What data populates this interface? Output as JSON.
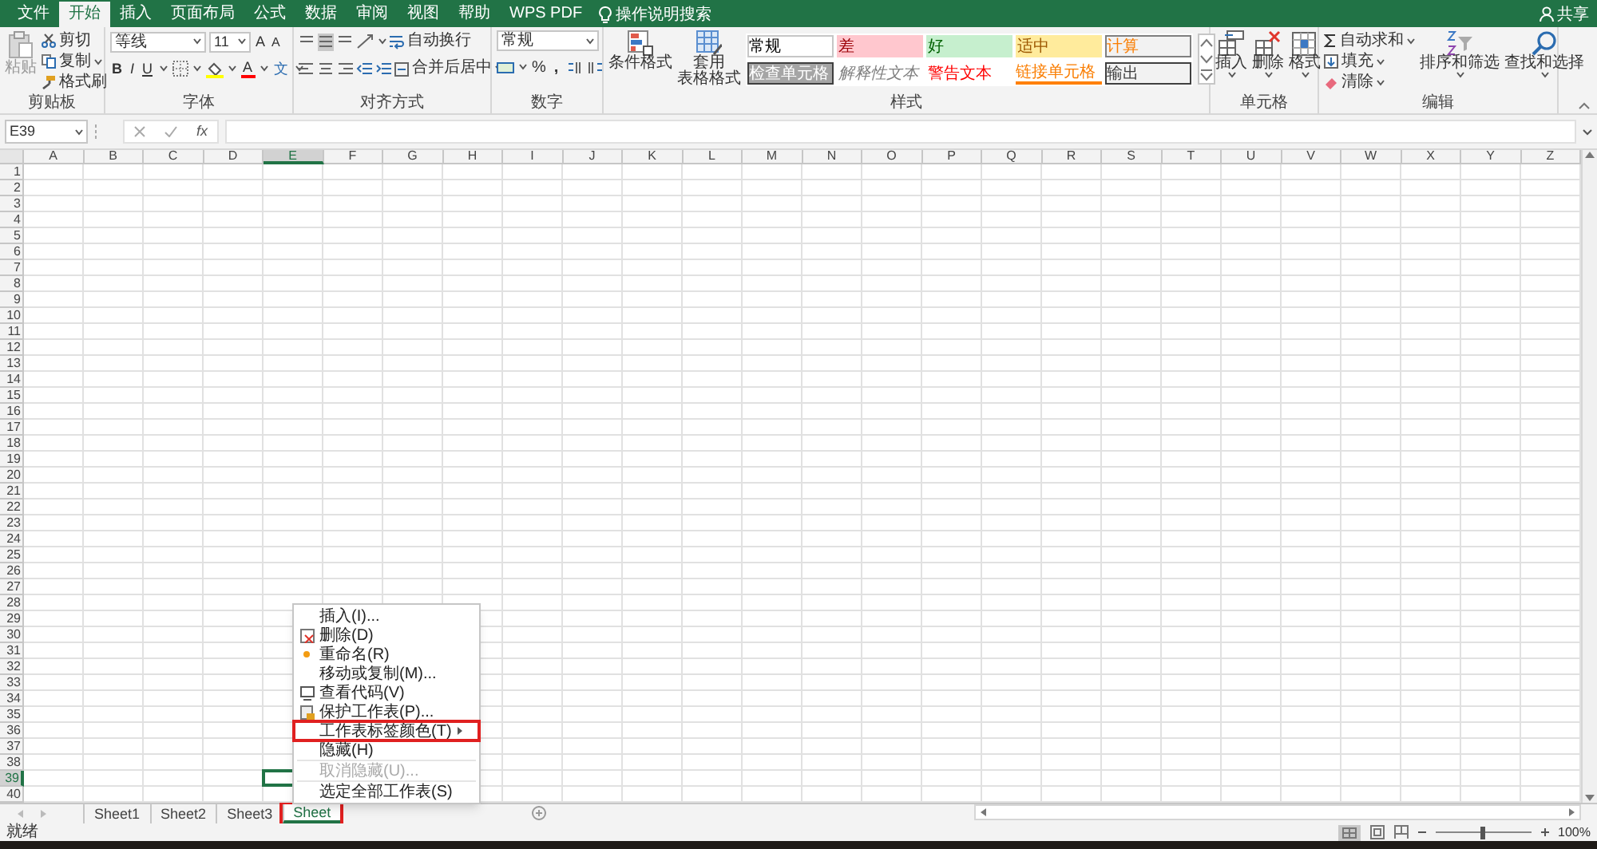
{
  "ribbon_tabs": [
    {
      "label": "文件",
      "selected": false
    },
    {
      "label": "开始",
      "selected": true
    },
    {
      "label": "插入",
      "selected": false
    },
    {
      "label": "页面布局",
      "selected": false
    },
    {
      "label": "公式",
      "selected": false
    },
    {
      "label": "数据",
      "selected": false
    },
    {
      "label": "审阅",
      "selected": false
    },
    {
      "label": "视图",
      "selected": false
    },
    {
      "label": "帮助",
      "selected": false
    },
    {
      "label": "WPS PDF",
      "selected": false
    }
  ],
  "tell_me": "操作说明搜索",
  "share": "共享",
  "clipboard": {
    "paste": "粘贴",
    "paste_disabled": true,
    "cut": "剪切",
    "copy": "复制",
    "format_painter": "格式刷",
    "label": "剪贴板"
  },
  "font": {
    "name": "等线",
    "size": "11",
    "grow": "A",
    "shrink": "A",
    "bold": "B",
    "italic": "I",
    "underline": "U",
    "color_letter": "A",
    "phonetic": "文",
    "label": "字体"
  },
  "alignment": {
    "wrap": "自动换行",
    "merge": "合并后居中",
    "label": "对齐方式"
  },
  "number": {
    "format": "常规",
    "percent": "%",
    "comma": ",",
    "label": "数字"
  },
  "styles": {
    "conditional": [
      "条件格式"
    ],
    "table": [
      "套用",
      "表格格式"
    ],
    "cell_styles": [
      {
        "label": "常规",
        "kind": "normal"
      },
      {
        "label": "差",
        "kind": "bad"
      },
      {
        "label": "好",
        "kind": "good"
      },
      {
        "label": "适中",
        "kind": "neutral"
      },
      {
        "label": "计算",
        "kind": "calculation"
      },
      {
        "label": "检查单元格",
        "kind": "check"
      },
      {
        "label": "解释性文本",
        "kind": "explanatory"
      },
      {
        "label": "警告文本",
        "kind": "warning"
      },
      {
        "label": "链接单元格",
        "kind": "linked"
      },
      {
        "label": "输出",
        "kind": "output"
      }
    ],
    "label": "样式"
  },
  "cells": {
    "buttons": [
      "插入",
      "删除",
      "格式"
    ],
    "label": "单元格"
  },
  "editing": {
    "autosum": "自动求和",
    "fill": "填充",
    "clear": "清除",
    "sort": "排序和筛选",
    "find": "查找和选择",
    "label": "编辑"
  },
  "formula_bar": {
    "name_box": "E39",
    "fx": "fx"
  },
  "columns": [
    {
      "label": "A",
      "selected": false
    },
    {
      "label": "B",
      "selected": false
    },
    {
      "label": "C",
      "selected": false
    },
    {
      "label": "D",
      "selected": false
    },
    {
      "label": "E",
      "selected": true
    },
    {
      "label": "F",
      "selected": false
    },
    {
      "label": "G",
      "selected": false
    },
    {
      "label": "H",
      "selected": false
    },
    {
      "label": "I",
      "selected": false
    },
    {
      "label": "J",
      "selected": false
    },
    {
      "label": "K",
      "selected": false
    },
    {
      "label": "L",
      "selected": false
    },
    {
      "label": "M",
      "selected": false
    },
    {
      "label": "N",
      "selected": false
    },
    {
      "label": "O",
      "selected": false
    },
    {
      "label": "P",
      "selected": false
    },
    {
      "label": "Q",
      "selected": false
    },
    {
      "label": "R",
      "selected": false
    },
    {
      "label": "S",
      "selected": false
    },
    {
      "label": "T",
      "selected": false
    },
    {
      "label": "U",
      "selected": false
    },
    {
      "label": "V",
      "selected": false
    },
    {
      "label": "W",
      "selected": false
    },
    {
      "label": "X",
      "selected": false
    },
    {
      "label": "Y",
      "selected": false
    },
    {
      "label": "Z",
      "selected": false
    }
  ],
  "rows": [
    {
      "label": "1",
      "selected": false
    },
    {
      "label": "2",
      "selected": false
    },
    {
      "label": "3",
      "selected": false
    },
    {
      "label": "4",
      "selected": false
    },
    {
      "label": "5",
      "selected": false
    },
    {
      "label": "6",
      "selected": false
    },
    {
      "label": "7",
      "selected": false
    },
    {
      "label": "8",
      "selected": false
    },
    {
      "label": "9",
      "selected": false
    },
    {
      "label": "10",
      "selected": false
    },
    {
      "label": "11",
      "selected": false
    },
    {
      "label": "12",
      "selected": false
    },
    {
      "label": "13",
      "selected": false
    },
    {
      "label": "14",
      "selected": false
    },
    {
      "label": "15",
      "selected": false
    },
    {
      "label": "16",
      "selected": false
    },
    {
      "label": "17",
      "selected": false
    },
    {
      "label": "18",
      "selected": false
    },
    {
      "label": "19",
      "selected": false
    },
    {
      "label": "20",
      "selected": false
    },
    {
      "label": "21",
      "selected": false
    },
    {
      "label": "22",
      "selected": false
    },
    {
      "label": "23",
      "selected": false
    },
    {
      "label": "24",
      "selected": false
    },
    {
      "label": "25",
      "selected": false
    },
    {
      "label": "26",
      "selected": false
    },
    {
      "label": "27",
      "selected": false
    },
    {
      "label": "28",
      "selected": false
    },
    {
      "label": "29",
      "selected": false
    },
    {
      "label": "30",
      "selected": false
    },
    {
      "label": "31",
      "selected": false
    },
    {
      "label": "32",
      "selected": false
    },
    {
      "label": "33",
      "selected": false
    },
    {
      "label": "34",
      "selected": false
    },
    {
      "label": "35",
      "selected": false
    },
    {
      "label": "36",
      "selected": false
    },
    {
      "label": "37",
      "selected": false
    },
    {
      "label": "38",
      "selected": false
    },
    {
      "label": "39",
      "selected": true
    },
    {
      "label": "40",
      "selected": false
    }
  ],
  "sheet_tabs": [
    {
      "label": "Sheet1",
      "selected": false,
      "outlined": false
    },
    {
      "label": "Sheet2",
      "selected": false,
      "outlined": false
    },
    {
      "label": "Sheet3",
      "selected": false,
      "outlined": false
    },
    {
      "label": "Sheet",
      "selected": true,
      "outlined": true
    }
  ],
  "context_menu": [
    {
      "label": "插入(I)...",
      "kind": "none",
      "disabled": false,
      "submenu": false,
      "outlined": false
    },
    {
      "label": "删除(D)",
      "kind": "delete",
      "disabled": false,
      "submenu": false,
      "outlined": false
    },
    {
      "label": "重命名(R)",
      "kind": "rename",
      "disabled": false,
      "submenu": false,
      "outlined": false
    },
    {
      "label": "移动或复制(M)...",
      "kind": "none",
      "disabled": false,
      "submenu": false,
      "outlined": false
    },
    {
      "label": "查看代码(V)",
      "kind": "code",
      "disabled": false,
      "submenu": false,
      "outlined": false
    },
    {
      "label": "保护工作表(P)...",
      "kind": "protect",
      "disabled": false,
      "submenu": false,
      "outlined": false
    },
    {
      "label": "工作表标签颜色(T)",
      "kind": "none",
      "disabled": false,
      "submenu": true,
      "outlined": true
    },
    {
      "label": "隐藏(H)",
      "kind": "none",
      "disabled": false,
      "submenu": false,
      "outlined": false
    },
    {
      "label": "取消隐藏(U)...",
      "kind": "none",
      "disabled": true,
      "submenu": false,
      "outlined": false
    },
    {
      "label": "选定全部工作表(S)",
      "kind": "none",
      "disabled": false,
      "submenu": false,
      "outlined": false
    }
  ],
  "status_bar": {
    "status": "就绪",
    "zoom": "100%",
    "zoom_slider": {
      "level": 0.5
    }
  }
}
